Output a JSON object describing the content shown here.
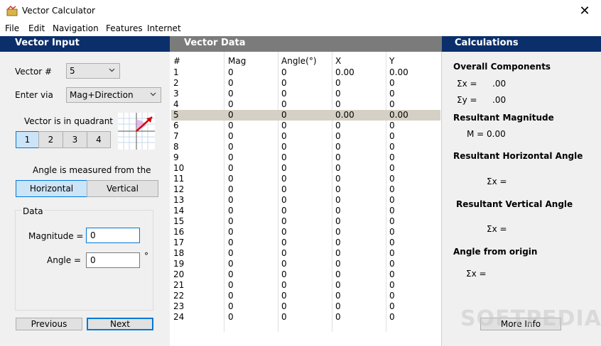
{
  "window": {
    "title": "Vector Calculator",
    "close_glyph": "✕"
  },
  "menu": [
    "File",
    "Edit",
    "Navigation",
    "Features",
    "Internet"
  ],
  "vector_input": {
    "header": "Vector Input",
    "vector_num_label": "Vector #",
    "vector_num_value": "5",
    "enter_via_label": "Enter via",
    "enter_via_value": "Mag+Direction",
    "quadrant_label": "Vector is in quadrant",
    "quadrants": [
      "1",
      "2",
      "3",
      "4"
    ],
    "selected_quadrant": "1",
    "angle_measured_label": "Angle is measured from the",
    "angle_options": [
      "Horizontal",
      "Vertical"
    ],
    "selected_angle_option": "Horizontal",
    "data_group_title": "Data",
    "magnitude_label": "Magnitude =",
    "magnitude_value": "0",
    "angle_label": "Angle =",
    "angle_value": "0",
    "degree_symbol": "°",
    "previous_label": "Previous",
    "next_label": "Next"
  },
  "vector_data": {
    "header": "Vector Data",
    "columns": [
      "#",
      "Mag",
      "Angle(°)",
      "X",
      "Y"
    ],
    "rows": [
      [
        "1",
        "0",
        "0",
        "0.00",
        "0.00"
      ],
      [
        "2",
        "0",
        "0",
        "0",
        "0"
      ],
      [
        "3",
        "0",
        "0",
        "0",
        "0"
      ],
      [
        "4",
        "0",
        "0",
        "0",
        "0"
      ],
      [
        "5",
        "0",
        "0",
        "0.00",
        "0.00"
      ],
      [
        "6",
        "0",
        "0",
        "0",
        "0"
      ],
      [
        "7",
        "0",
        "0",
        "0",
        "0"
      ],
      [
        "8",
        "0",
        "0",
        "0",
        "0"
      ],
      [
        "9",
        "0",
        "0",
        "0",
        "0"
      ],
      [
        "10",
        "0",
        "0",
        "0",
        "0"
      ],
      [
        "11",
        "0",
        "0",
        "0",
        "0"
      ],
      [
        "12",
        "0",
        "0",
        "0",
        "0"
      ],
      [
        "13",
        "0",
        "0",
        "0",
        "0"
      ],
      [
        "14",
        "0",
        "0",
        "0",
        "0"
      ],
      [
        "15",
        "0",
        "0",
        "0",
        "0"
      ],
      [
        "16",
        "0",
        "0",
        "0",
        "0"
      ],
      [
        "17",
        "0",
        "0",
        "0",
        "0"
      ],
      [
        "18",
        "0",
        "0",
        "0",
        "0"
      ],
      [
        "19",
        "0",
        "0",
        "0",
        "0"
      ],
      [
        "20",
        "0",
        "0",
        "0",
        "0"
      ],
      [
        "21",
        "0",
        "0",
        "0",
        "0"
      ],
      [
        "22",
        "0",
        "0",
        "0",
        "0"
      ],
      [
        "23",
        "0",
        "0",
        "0",
        "0"
      ],
      [
        "24",
        "0",
        "0",
        "0",
        "0"
      ]
    ],
    "selected_row": "5"
  },
  "calculations": {
    "header": "Calculations",
    "overall_components_title": "Overall Components",
    "sum_x_label": "Σx =",
    "sum_x_value": ".00",
    "sum_y_label": "Σy =",
    "sum_y_value": ".00",
    "resultant_magnitude_title": "Resultant Magnitude",
    "magnitude_line": "M = 0.00",
    "horizontal_angle_title": "Resultant Horizontal Angle",
    "horizontal_angle_line": "Σx =",
    "vertical_angle_title": "Resultant Vertical Angle",
    "vertical_angle_line": "Σx =",
    "angle_origin_title": "Angle from origin",
    "angle_origin_line": "Σx =",
    "more_info_label": "More Info"
  },
  "watermark": "SOFTPEDIA",
  "colors": {
    "header_blue": "#0a2f6b",
    "header_gray": "#7b7b7b",
    "selected_row": "#d5d0c5",
    "focus_blue": "#0078d7"
  }
}
